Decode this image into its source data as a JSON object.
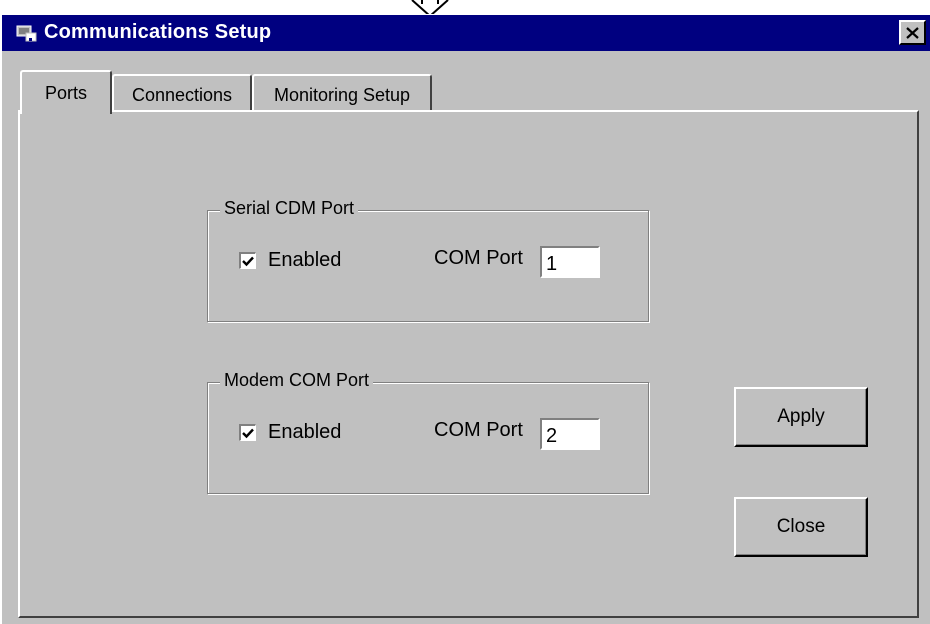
{
  "window": {
    "title": "Communications Setup",
    "titlebar_color": "#000080",
    "face_color": "#c0c0c0",
    "icons": {
      "app": "app-window-icon",
      "close": "close-x-icon"
    }
  },
  "tabs": [
    {
      "label": "Ports",
      "selected": true
    },
    {
      "label": "Connections",
      "selected": false
    },
    {
      "label": "Monitoring Setup",
      "selected": false
    }
  ],
  "groups": {
    "serial": {
      "title": "Serial CDM Port",
      "enabled_label": "Enabled",
      "enabled": true,
      "com_label": "COM Port",
      "com_value": "1"
    },
    "modem": {
      "title": "Modem COM Port",
      "enabled_label": "Enabled",
      "enabled": true,
      "com_label": "COM Port",
      "com_value": "2"
    }
  },
  "buttons": {
    "apply": "Apply",
    "close": "Close"
  }
}
